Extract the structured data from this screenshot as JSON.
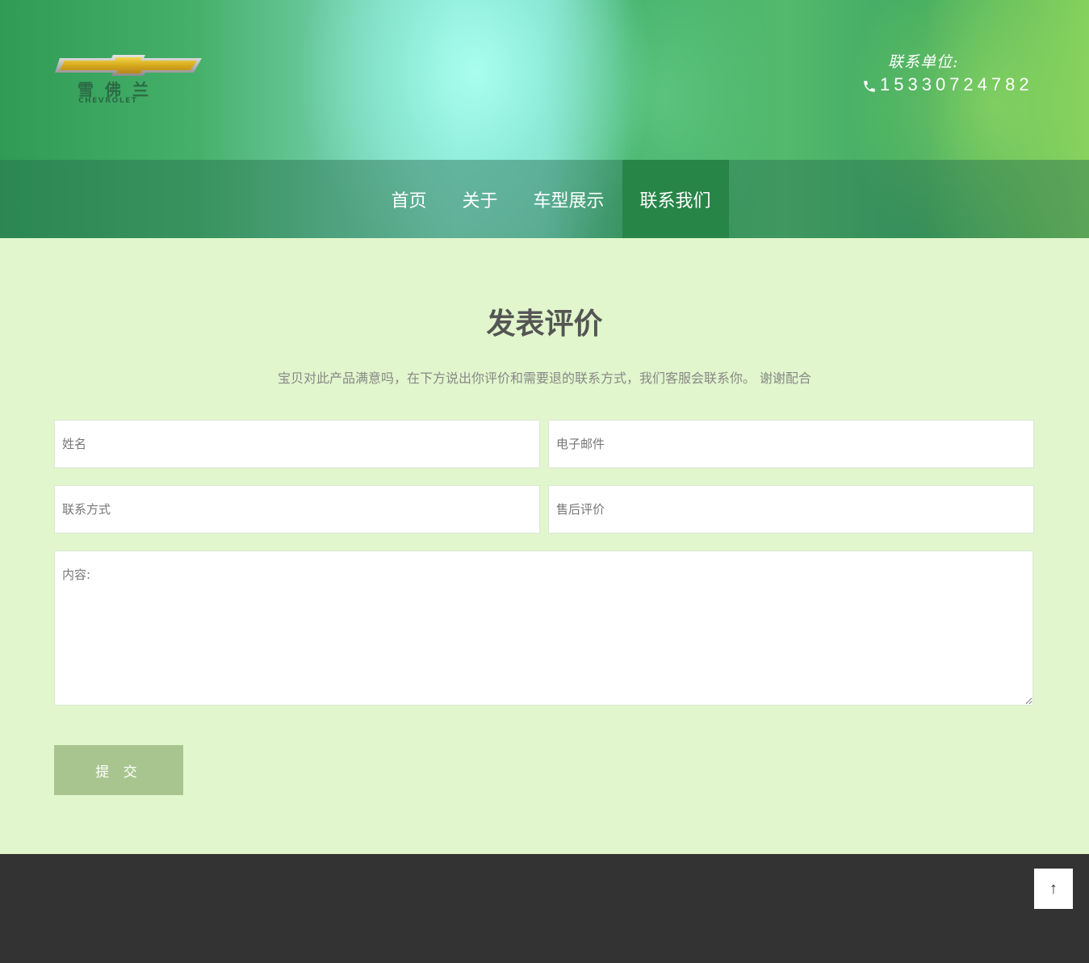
{
  "header": {
    "logo_text": "雪佛兰",
    "logo_subtext": "CHEVROLET",
    "contact_label": "联系单位:",
    "contact_phone": "15330724782"
  },
  "nav": {
    "items": [
      {
        "label": "首页"
      },
      {
        "label": "关于"
      },
      {
        "label": "车型展示"
      },
      {
        "label": "联系我们"
      }
    ],
    "active_index": 3
  },
  "main": {
    "title": "发表评价",
    "description": "宝贝对此产品满意吗，在下方说出你评价和需要退的联系方式，我们客服会联系你。 谢谢配合",
    "form": {
      "name_placeholder": "姓名",
      "email_placeholder": "电子邮件",
      "phone_placeholder": "联系方式",
      "review_placeholder": "售后评价",
      "content_placeholder": "内容:",
      "submit_label": "提 交"
    }
  },
  "footer": {
    "to_top_label": "↑"
  },
  "colors": {
    "page_bg": "#e1f6cc",
    "nav_active": "#278548",
    "button_bg": "#a9c58f",
    "footer_bg": "#333333"
  }
}
